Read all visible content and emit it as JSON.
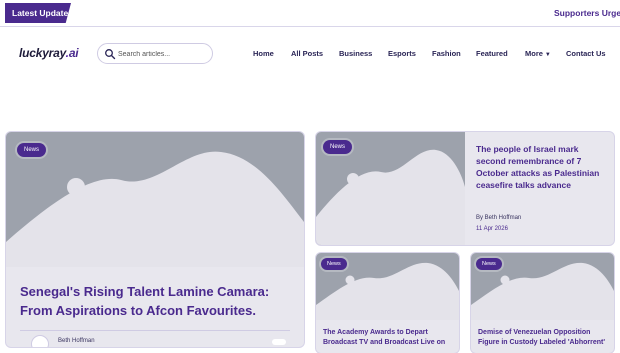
{
  "topbar": {
    "latest_label": "Latest Update",
    "ticker_text": "Supporters Urge"
  },
  "header": {
    "logo": {
      "name": "luckyray",
      "separator": ".",
      "tld": "ai"
    },
    "search": {
      "placeholder": "Search articles..."
    },
    "nav": [
      {
        "label": "Home"
      },
      {
        "label": "All Posts"
      },
      {
        "label": "Business"
      },
      {
        "label": "Esports"
      },
      {
        "label": "Fashion"
      },
      {
        "label": "Featured"
      },
      {
        "label": "More",
        "icon": "caret-down-icon"
      },
      {
        "label": "Contact Us"
      }
    ]
  },
  "colors": {
    "accent": "#4a2a8e",
    "placeholder_bg": "#9da2ac",
    "placeholder_shape": "#e4e3ea"
  },
  "articles": [
    {
      "category": "News",
      "title": "Senegal's Rising Talent Lamine Camara: From Aspirations to Afcon Favourites.",
      "author": "Beth Hoffman"
    },
    {
      "category": "News",
      "title": "The people of Israel mark second remembrance of 7 October attacks as Palestinian ceasefire talks advance",
      "author": "By Beth Hoffman",
      "date": "11 Apr 2026"
    },
    {
      "category": "News",
      "title": "The Academy Awards to Depart Broadcast TV and Broadcast Live on"
    },
    {
      "category": "News",
      "title": "Demise of Venezuelan Opposition Figure in Custody Labeled 'Abhorrent'"
    }
  ]
}
